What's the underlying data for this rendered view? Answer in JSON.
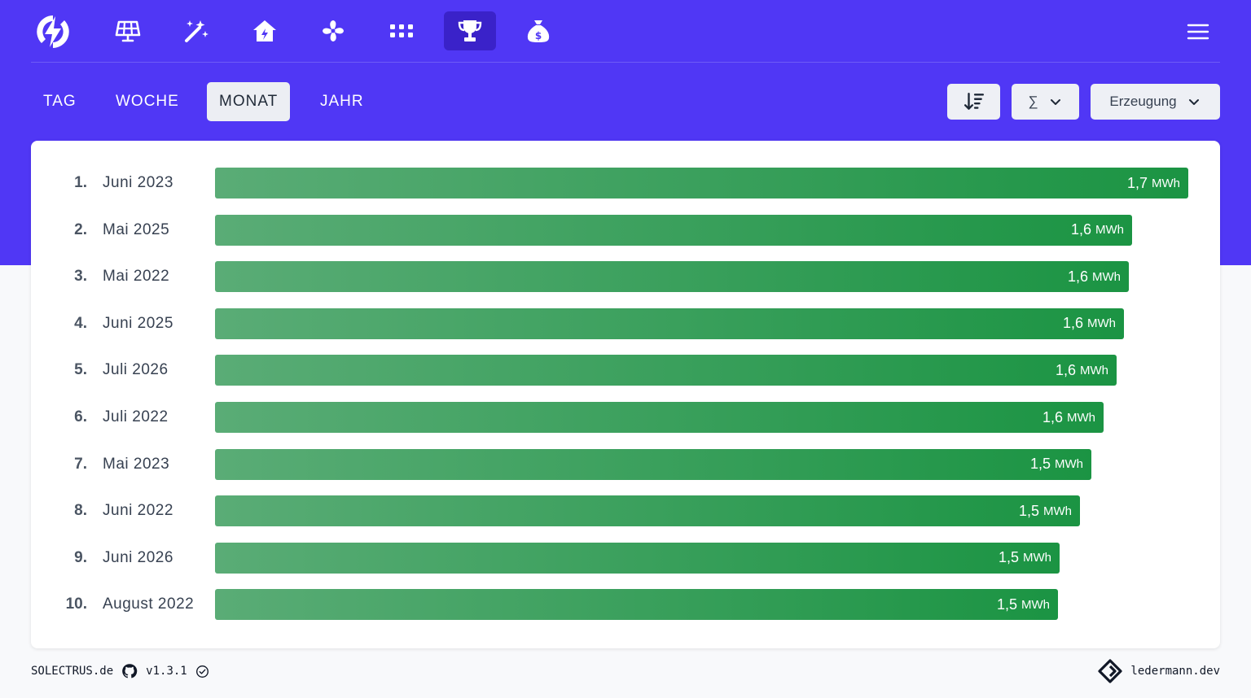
{
  "colors": {
    "header_bg": "#5037f5",
    "active_nav_bg": "#3a22c9",
    "bar_start": "#5aac76",
    "bar_end": "#1b9443",
    "tab_active_bg": "#eceef3"
  },
  "nav": {
    "logo_icon": "solectrus-bolt-logo-icon",
    "items": [
      {
        "icon": "solar-panel-icon",
        "active": false
      },
      {
        "icon": "magic-wand-icon",
        "active": false
      },
      {
        "icon": "house-icon",
        "active": false
      },
      {
        "icon": "fan-icon",
        "active": false
      },
      {
        "icon": "grid-dots-icon",
        "active": false
      },
      {
        "icon": "trophy-icon",
        "active": true
      },
      {
        "icon": "money-bag-icon",
        "active": false
      }
    ],
    "menu_icon": "hamburger-menu-icon"
  },
  "tabs": [
    {
      "label": "TAG",
      "active": false
    },
    {
      "label": "WOCHE",
      "active": false
    },
    {
      "label": "MONAT",
      "active": true
    },
    {
      "label": "JAHR",
      "active": false
    }
  ],
  "controls": {
    "sort_icon": "sort-descending-icon",
    "aggregate_label": "∑",
    "metric_label": "Erzeugung"
  },
  "chart_data": {
    "type": "bar",
    "orientation": "horizontal",
    "unit": "MWh",
    "categories": [
      "Juni 2023",
      "Mai 2025",
      "Mai 2022",
      "Juni 2025",
      "Juli 2026",
      "Juli 2022",
      "Mai 2023",
      "Juni 2022",
      "Juni 2026",
      "August 2022"
    ],
    "ranks": [
      "1.",
      "2.",
      "3.",
      "4.",
      "5.",
      "6.",
      "7.",
      "8.",
      "9.",
      "10."
    ],
    "values": [
      1.72,
      1.62,
      1.615,
      1.607,
      1.594,
      1.57,
      1.548,
      1.528,
      1.493,
      1.49
    ],
    "value_labels": [
      "1,7",
      "1,6",
      "1,6",
      "1,6",
      "1,6",
      "1,6",
      "1,5",
      "1,5",
      "1,5",
      "1,5"
    ],
    "xlim": [
      0,
      1.72
    ]
  },
  "footer": {
    "brand": "SOLECTRUS.de",
    "version": "v1.3.1",
    "author": "ledermann.dev"
  }
}
